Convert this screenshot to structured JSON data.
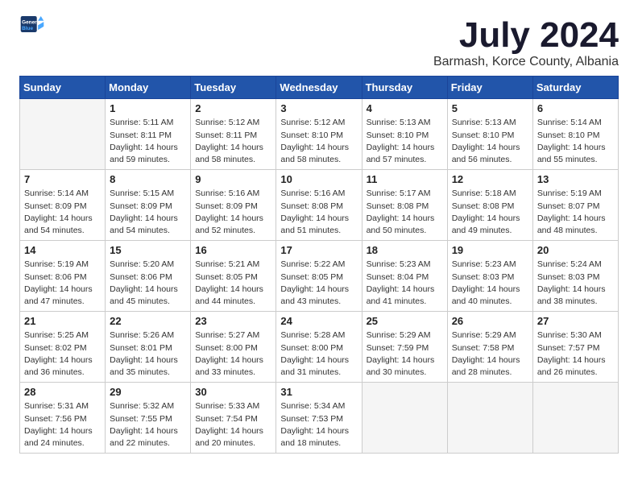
{
  "logo": {
    "general": "General",
    "blue": "Blue"
  },
  "title": "July 2024",
  "subtitle": "Barmash, Korce County, Albania",
  "days_of_week": [
    "Sunday",
    "Monday",
    "Tuesday",
    "Wednesday",
    "Thursday",
    "Friday",
    "Saturday"
  ],
  "weeks": [
    [
      {
        "day": "",
        "info": ""
      },
      {
        "day": "1",
        "info": "Sunrise: 5:11 AM\nSunset: 8:11 PM\nDaylight: 14 hours\nand 59 minutes."
      },
      {
        "day": "2",
        "info": "Sunrise: 5:12 AM\nSunset: 8:11 PM\nDaylight: 14 hours\nand 58 minutes."
      },
      {
        "day": "3",
        "info": "Sunrise: 5:12 AM\nSunset: 8:10 PM\nDaylight: 14 hours\nand 58 minutes."
      },
      {
        "day": "4",
        "info": "Sunrise: 5:13 AM\nSunset: 8:10 PM\nDaylight: 14 hours\nand 57 minutes."
      },
      {
        "day": "5",
        "info": "Sunrise: 5:13 AM\nSunset: 8:10 PM\nDaylight: 14 hours\nand 56 minutes."
      },
      {
        "day": "6",
        "info": "Sunrise: 5:14 AM\nSunset: 8:10 PM\nDaylight: 14 hours\nand 55 minutes."
      }
    ],
    [
      {
        "day": "7",
        "info": "Sunrise: 5:14 AM\nSunset: 8:09 PM\nDaylight: 14 hours\nand 54 minutes."
      },
      {
        "day": "8",
        "info": "Sunrise: 5:15 AM\nSunset: 8:09 PM\nDaylight: 14 hours\nand 54 minutes."
      },
      {
        "day": "9",
        "info": "Sunrise: 5:16 AM\nSunset: 8:09 PM\nDaylight: 14 hours\nand 52 minutes."
      },
      {
        "day": "10",
        "info": "Sunrise: 5:16 AM\nSunset: 8:08 PM\nDaylight: 14 hours\nand 51 minutes."
      },
      {
        "day": "11",
        "info": "Sunrise: 5:17 AM\nSunset: 8:08 PM\nDaylight: 14 hours\nand 50 minutes."
      },
      {
        "day": "12",
        "info": "Sunrise: 5:18 AM\nSunset: 8:08 PM\nDaylight: 14 hours\nand 49 minutes."
      },
      {
        "day": "13",
        "info": "Sunrise: 5:19 AM\nSunset: 8:07 PM\nDaylight: 14 hours\nand 48 minutes."
      }
    ],
    [
      {
        "day": "14",
        "info": "Sunrise: 5:19 AM\nSunset: 8:06 PM\nDaylight: 14 hours\nand 47 minutes."
      },
      {
        "day": "15",
        "info": "Sunrise: 5:20 AM\nSunset: 8:06 PM\nDaylight: 14 hours\nand 45 minutes."
      },
      {
        "day": "16",
        "info": "Sunrise: 5:21 AM\nSunset: 8:05 PM\nDaylight: 14 hours\nand 44 minutes."
      },
      {
        "day": "17",
        "info": "Sunrise: 5:22 AM\nSunset: 8:05 PM\nDaylight: 14 hours\nand 43 minutes."
      },
      {
        "day": "18",
        "info": "Sunrise: 5:23 AM\nSunset: 8:04 PM\nDaylight: 14 hours\nand 41 minutes."
      },
      {
        "day": "19",
        "info": "Sunrise: 5:23 AM\nSunset: 8:03 PM\nDaylight: 14 hours\nand 40 minutes."
      },
      {
        "day": "20",
        "info": "Sunrise: 5:24 AM\nSunset: 8:03 PM\nDaylight: 14 hours\nand 38 minutes."
      }
    ],
    [
      {
        "day": "21",
        "info": "Sunrise: 5:25 AM\nSunset: 8:02 PM\nDaylight: 14 hours\nand 36 minutes."
      },
      {
        "day": "22",
        "info": "Sunrise: 5:26 AM\nSunset: 8:01 PM\nDaylight: 14 hours\nand 35 minutes."
      },
      {
        "day": "23",
        "info": "Sunrise: 5:27 AM\nSunset: 8:00 PM\nDaylight: 14 hours\nand 33 minutes."
      },
      {
        "day": "24",
        "info": "Sunrise: 5:28 AM\nSunset: 8:00 PM\nDaylight: 14 hours\nand 31 minutes."
      },
      {
        "day": "25",
        "info": "Sunrise: 5:29 AM\nSunset: 7:59 PM\nDaylight: 14 hours\nand 30 minutes."
      },
      {
        "day": "26",
        "info": "Sunrise: 5:29 AM\nSunset: 7:58 PM\nDaylight: 14 hours\nand 28 minutes."
      },
      {
        "day": "27",
        "info": "Sunrise: 5:30 AM\nSunset: 7:57 PM\nDaylight: 14 hours\nand 26 minutes."
      }
    ],
    [
      {
        "day": "28",
        "info": "Sunrise: 5:31 AM\nSunset: 7:56 PM\nDaylight: 14 hours\nand 24 minutes."
      },
      {
        "day": "29",
        "info": "Sunrise: 5:32 AM\nSunset: 7:55 PM\nDaylight: 14 hours\nand 22 minutes."
      },
      {
        "day": "30",
        "info": "Sunrise: 5:33 AM\nSunset: 7:54 PM\nDaylight: 14 hours\nand 20 minutes."
      },
      {
        "day": "31",
        "info": "Sunrise: 5:34 AM\nSunset: 7:53 PM\nDaylight: 14 hours\nand 18 minutes."
      },
      {
        "day": "",
        "info": ""
      },
      {
        "day": "",
        "info": ""
      },
      {
        "day": "",
        "info": ""
      }
    ]
  ]
}
